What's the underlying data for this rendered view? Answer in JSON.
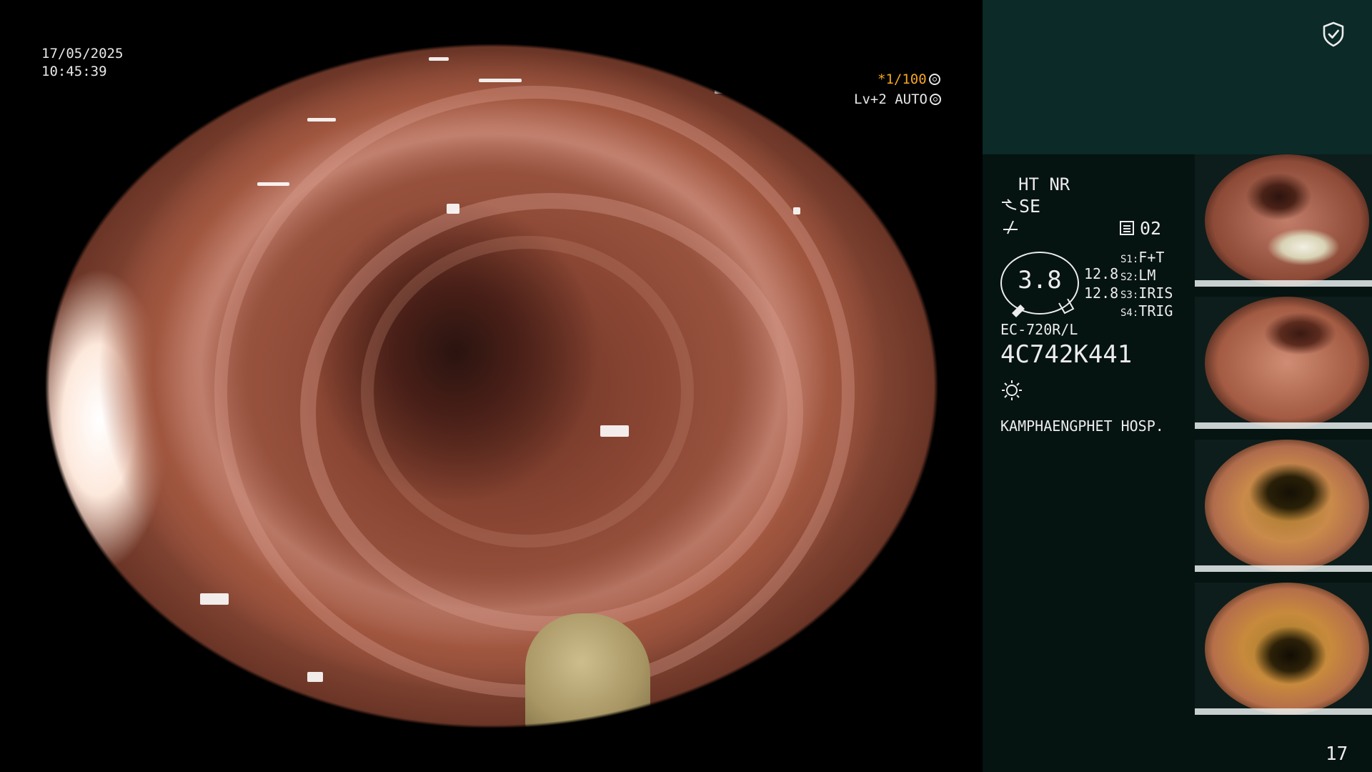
{
  "overlay": {
    "date": "17/05/2025",
    "time": "10:45:39",
    "shutter": "*1/100",
    "level": "Lv+2 AUTO"
  },
  "panel": {
    "mode": "HT NR",
    "se_label": "SE",
    "memory_label": "02",
    "gauge_value": "3.8",
    "values": [
      "12.8",
      "12.8"
    ],
    "switches": [
      {
        "key": "S1:",
        "value": "F+T"
      },
      {
        "key": "S2:",
        "value": "LM"
      },
      {
        "key": "S3:",
        "value": "IRIS"
      },
      {
        "key": "S4:",
        "value": "TRIG"
      }
    ],
    "scope_model": "EC-720R/L",
    "serial": "4C742K441",
    "hospital": "KAMPHAENGPHET HOSP.",
    "page_number": "17"
  },
  "colors": {
    "accent": "#f5a623",
    "panel_top": "#0b2a28",
    "panel_bg": "#051311"
  }
}
